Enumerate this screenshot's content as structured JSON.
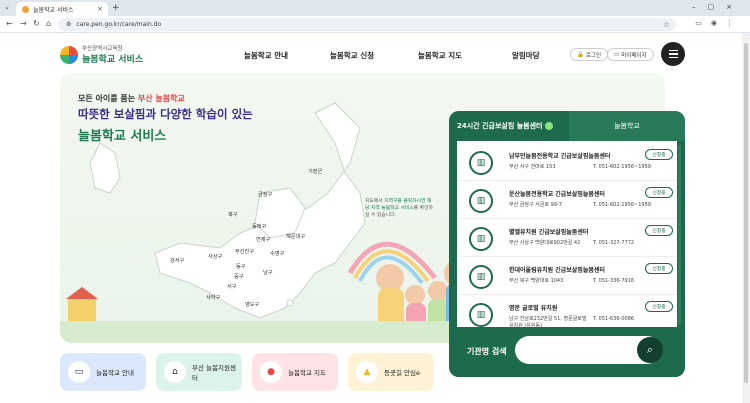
{
  "browser": {
    "tab_title": "늘봄학교 서비스",
    "url": "care.pen.go.kr/care/main.do"
  },
  "header": {
    "logo_top": "부산광역시교육청",
    "logo_main": "늘봄학교",
    "logo_main_suffix": "서비스",
    "nav": [
      "늘봄학교 안내",
      "늘봄학교 신청",
      "늘봄학교 지도",
      "알림마당"
    ],
    "login": "로그인",
    "mypage": "마이페이지"
  },
  "hero": {
    "line1_a": "모든 아이를 품는",
    "line1_b": "부산 늘봄학교",
    "line2_a": "따뜻한 보살핌과 다양한 학습",
    "line2_b": "이 있는",
    "line3_a": "늘봄학교",
    "line3_b": "서비스",
    "map_note_a": "지도에서",
    "map_note_hl": "지역구를 클릭하시면 해당 지역 늘봄학교 서비스",
    "map_note_b": "를 확인하실 수 있습니다.",
    "regions": [
      "기장군",
      "금정구",
      "북구",
      "동래구",
      "해운대구",
      "강서구",
      "사상구",
      "부산진구",
      "연제구",
      "수영구",
      "사하구",
      "서구",
      "중구",
      "동구",
      "남구",
      "영도구"
    ]
  },
  "panel": {
    "tab_active": "24시간 긴급보살핌 늘봄센터",
    "tab_other": "늘봄학교",
    "apply_label": "신청중",
    "items": [
      {
        "name": "남부민늘봄전용학교 긴급보살핌늘봄센터",
        "addr": "부산 서구 천마로 153",
        "tel": "T. 051-602-1956~1959"
      },
      {
        "name": "운산늘봄전용학교 긴급보살핌늘봄센터",
        "addr": "부산 금정구 서금로 99-7",
        "tel": "T. 051-602-1956~1959"
      },
      {
        "name": "별엘유치원 긴급보살핌늘봄센터",
        "addr": "부산 사상구 백양대로902번길 42",
        "tel": "T. 051-327-7772"
      },
      {
        "name": "한대어울림유치원 긴급보살핌늘봄센터",
        "addr": "부산 북구 백양대로 1043",
        "tel": "T. 051-336-7916"
      },
      {
        "name": "명문 글로벌 유치원",
        "addr": "남구 진남로232번길 51, 명문글로벌유치원 (유원동)",
        "tel": "T. 051-636-0086"
      }
    ],
    "search_label": "기관명 검색",
    "search_placeholder": ""
  },
  "quick": [
    {
      "label": "늘봄학교 안내",
      "icon": "monitor-icon",
      "bg": "#dbe8fb"
    },
    {
      "label": "부산 늘봄지원센터",
      "icon": "house-icon",
      "bg": "#dcf3ec"
    },
    {
      "label": "늘봄학교 지도",
      "icon": "map-pin-icon",
      "bg": "#fde3e5"
    },
    {
      "label": "등굣길 안심e",
      "icon": "shirt-icon",
      "bg": "#fdf1d6"
    }
  ],
  "colors": {
    "brand_green": "#1e6a4c",
    "accent_red": "#e6464c",
    "accent_purple": "#3c2f8a"
  }
}
